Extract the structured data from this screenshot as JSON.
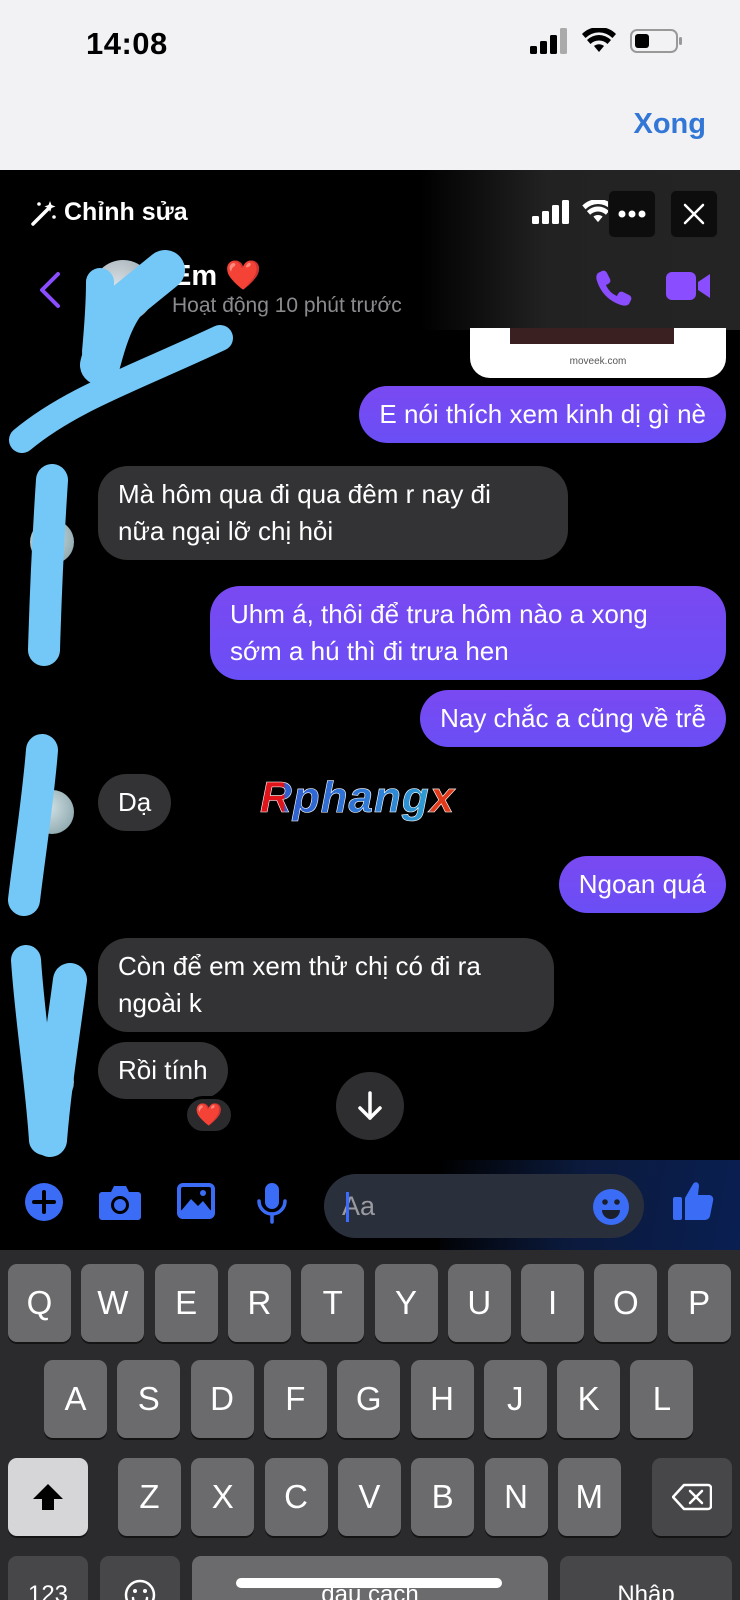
{
  "status_bar": {
    "time": "14:08"
  },
  "top_bar": {
    "done_label": "Xong"
  },
  "inner_status": {
    "edit_label": "Chỉnh sửa"
  },
  "chat_header": {
    "name": "Em",
    "heart": "❤️",
    "status": "Hoạt động 10 phút trước"
  },
  "link_preview": {
    "url": "moveek.com"
  },
  "messages": [
    {
      "side": "out",
      "text": "E nói thích xem kinh dị gì nè"
    },
    {
      "side": "in",
      "text": "Mà hôm qua đi qua đêm r nay đi\nnữa ngại lỡ chị hỏi"
    },
    {
      "side": "out",
      "text": "Uhm á, thôi để trưa hôm nào a xong\nsớm a hú thì đi trưa hen"
    },
    {
      "side": "out",
      "text": "Nay chắc a cũng về trễ"
    },
    {
      "side": "in",
      "text": "Dạ"
    },
    {
      "side": "out",
      "text": "Ngoan quá"
    },
    {
      "side": "in",
      "text": "Còn để em xem thử chị có đi ra\nngoài k"
    },
    {
      "side": "in",
      "text": "Rồi tính"
    }
  ],
  "reaction": "❤️",
  "watermark": "Rphangx",
  "composer": {
    "placeholder": "Aa"
  },
  "keyboard": {
    "row1": [
      "Q",
      "W",
      "E",
      "R",
      "T",
      "Y",
      "U",
      "I",
      "O",
      "P"
    ],
    "row2": [
      "A",
      "S",
      "D",
      "F",
      "G",
      "H",
      "J",
      "K",
      "L"
    ],
    "row3": [
      "Z",
      "X",
      "C",
      "V",
      "B",
      "N",
      "M"
    ],
    "numbers_label": "123",
    "space_label": "dấu cách",
    "return_label": "Nhập"
  },
  "colors": {
    "accent": "#7249f4",
    "incoming": "#333335",
    "link": "#3277d6",
    "messenger_purple": "#8a4dff"
  },
  "icons": [
    "signal-icon",
    "wifi-icon",
    "battery-icon",
    "magic-wand-icon",
    "more-icon",
    "close-icon",
    "back-chevron-icon",
    "phone-icon",
    "video-icon",
    "arrow-down-icon",
    "plus-icon",
    "camera-icon",
    "image-icon",
    "mic-icon",
    "emoji-icon",
    "thumbs-up-icon",
    "shift-icon",
    "backspace-icon"
  ]
}
